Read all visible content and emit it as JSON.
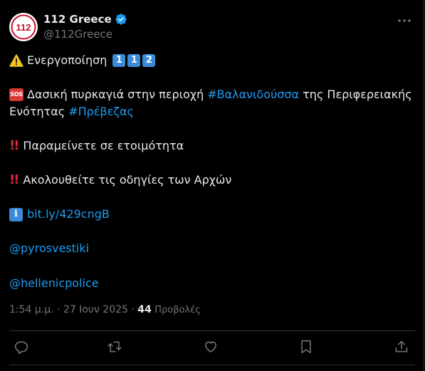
{
  "account": {
    "display_name": "112 Greece",
    "handle": "@112Greece",
    "avatar_text": "112"
  },
  "tweet": {
    "line1_text": "Ενεργοποίηση",
    "keycaps": [
      "1",
      "1",
      "2"
    ],
    "line2_text": "Δασική πυρκαγιά στην περιοχή",
    "line2_hashtag": "#Βαλανιδούσσα",
    "line2_suffix": "της Περιφερειακής",
    "line3_text": "Ενότητας",
    "line3_hashtag": "#Πρέβεζας",
    "line4_text": "Παραμείνετε σε ετοιμότητα",
    "line5_text": "Ακολουθείτε τις οδηγίες των Αρχών",
    "link": "bit.ly/429cngB",
    "mention1": "@pyrosvestiki",
    "mention2": "@hellenicpolice",
    "sos_label": "SOS",
    "info_label": "i"
  },
  "meta": {
    "timestamp": "1:54 μ.μ. · 27 Ιουν 2025 ·",
    "views_count": "44",
    "views_label": "Προβολές"
  },
  "colors": {
    "background": "#000000",
    "text": "#e7e9ea",
    "muted": "#71767b",
    "link": "#1d9bf0",
    "verified": "#1d9bf0"
  }
}
